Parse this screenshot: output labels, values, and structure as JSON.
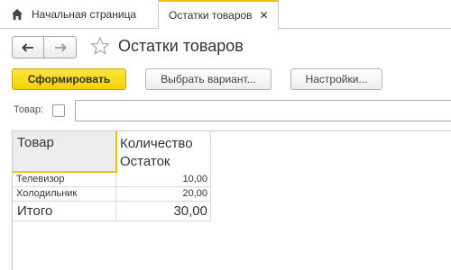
{
  "tabs": {
    "home_label": "Начальная страница",
    "active_label": "Остатки товаров",
    "home_icon": "home-icon",
    "close_icon": "close-icon"
  },
  "header": {
    "title": "Остатки товаров",
    "back_icon": "arrow-left-icon",
    "forward_icon": "arrow-right-icon",
    "favorite_icon": "star-icon"
  },
  "toolbar": {
    "generate_label": "Сформировать",
    "variant_label": "Выбрать вариант...",
    "settings_label": "Настройки..."
  },
  "filter": {
    "label": "Товар:",
    "checked": false,
    "value": ""
  },
  "report": {
    "columns": [
      "Товар",
      "Количество",
      "Остаток"
    ],
    "rows": [
      {
        "name": "Телевизор",
        "value": "10,00"
      },
      {
        "name": "Холодильник",
        "value": "20,00"
      }
    ],
    "total": {
      "name": "Итого",
      "value": "30,00"
    }
  },
  "colors": {
    "accent": "#f2c100",
    "primary_button": "#f4d200",
    "header_bg": "#ededed"
  }
}
